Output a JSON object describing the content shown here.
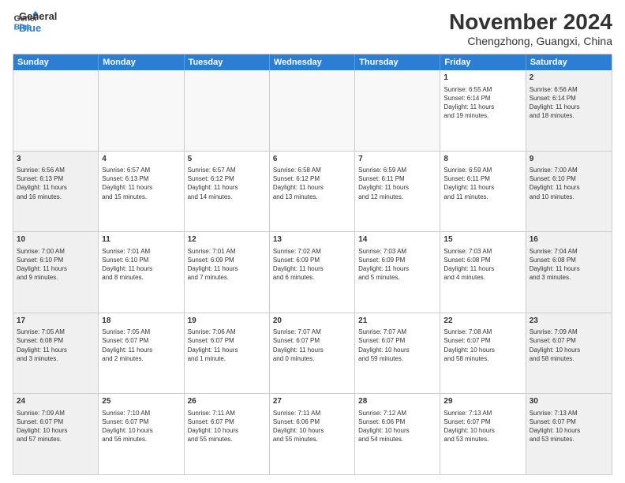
{
  "logo": {
    "line1": "General",
    "line2": "Blue"
  },
  "title": "November 2024",
  "location": "Chengzhong, Guangxi, China",
  "header_days": [
    "Sunday",
    "Monday",
    "Tuesday",
    "Wednesday",
    "Thursday",
    "Friday",
    "Saturday"
  ],
  "rows": [
    [
      {
        "day": "",
        "info": "",
        "empty": true
      },
      {
        "day": "",
        "info": "",
        "empty": true
      },
      {
        "day": "",
        "info": "",
        "empty": true
      },
      {
        "day": "",
        "info": "",
        "empty": true
      },
      {
        "day": "",
        "info": "",
        "empty": true
      },
      {
        "day": "1",
        "info": "Sunrise: 6:55 AM\nSunset: 6:14 PM\nDaylight: 11 hours\nand 19 minutes.",
        "empty": false
      },
      {
        "day": "2",
        "info": "Sunrise: 6:56 AM\nSunset: 6:14 PM\nDaylight: 11 hours\nand 18 minutes.",
        "empty": false
      }
    ],
    [
      {
        "day": "3",
        "info": "Sunrise: 6:56 AM\nSunset: 6:13 PM\nDaylight: 11 hours\nand 16 minutes.",
        "empty": false
      },
      {
        "day": "4",
        "info": "Sunrise: 6:57 AM\nSunset: 6:13 PM\nDaylight: 11 hours\nand 15 minutes.",
        "empty": false
      },
      {
        "day": "5",
        "info": "Sunrise: 6:57 AM\nSunset: 6:12 PM\nDaylight: 11 hours\nand 14 minutes.",
        "empty": false
      },
      {
        "day": "6",
        "info": "Sunrise: 6:58 AM\nSunset: 6:12 PM\nDaylight: 11 hours\nand 13 minutes.",
        "empty": false
      },
      {
        "day": "7",
        "info": "Sunrise: 6:59 AM\nSunset: 6:11 PM\nDaylight: 11 hours\nand 12 minutes.",
        "empty": false
      },
      {
        "day": "8",
        "info": "Sunrise: 6:59 AM\nSunset: 6:11 PM\nDaylight: 11 hours\nand 11 minutes.",
        "empty": false
      },
      {
        "day": "9",
        "info": "Sunrise: 7:00 AM\nSunset: 6:10 PM\nDaylight: 11 hours\nand 10 minutes.",
        "empty": false
      }
    ],
    [
      {
        "day": "10",
        "info": "Sunrise: 7:00 AM\nSunset: 6:10 PM\nDaylight: 11 hours\nand 9 minutes.",
        "empty": false
      },
      {
        "day": "11",
        "info": "Sunrise: 7:01 AM\nSunset: 6:10 PM\nDaylight: 11 hours\nand 8 minutes.",
        "empty": false
      },
      {
        "day": "12",
        "info": "Sunrise: 7:01 AM\nSunset: 6:09 PM\nDaylight: 11 hours\nand 7 minutes.",
        "empty": false
      },
      {
        "day": "13",
        "info": "Sunrise: 7:02 AM\nSunset: 6:09 PM\nDaylight: 11 hours\nand 6 minutes.",
        "empty": false
      },
      {
        "day": "14",
        "info": "Sunrise: 7:03 AM\nSunset: 6:09 PM\nDaylight: 11 hours\nand 5 minutes.",
        "empty": false
      },
      {
        "day": "15",
        "info": "Sunrise: 7:03 AM\nSunset: 6:08 PM\nDaylight: 11 hours\nand 4 minutes.",
        "empty": false
      },
      {
        "day": "16",
        "info": "Sunrise: 7:04 AM\nSunset: 6:08 PM\nDaylight: 11 hours\nand 3 minutes.",
        "empty": false
      }
    ],
    [
      {
        "day": "17",
        "info": "Sunrise: 7:05 AM\nSunset: 6:08 PM\nDaylight: 11 hours\nand 3 minutes.",
        "empty": false
      },
      {
        "day": "18",
        "info": "Sunrise: 7:05 AM\nSunset: 6:07 PM\nDaylight: 11 hours\nand 2 minutes.",
        "empty": false
      },
      {
        "day": "19",
        "info": "Sunrise: 7:06 AM\nSunset: 6:07 PM\nDaylight: 11 hours\nand 1 minute.",
        "empty": false
      },
      {
        "day": "20",
        "info": "Sunrise: 7:07 AM\nSunset: 6:07 PM\nDaylight: 11 hours\nand 0 minutes.",
        "empty": false
      },
      {
        "day": "21",
        "info": "Sunrise: 7:07 AM\nSunset: 6:07 PM\nDaylight: 10 hours\nand 59 minutes.",
        "empty": false
      },
      {
        "day": "22",
        "info": "Sunrise: 7:08 AM\nSunset: 6:07 PM\nDaylight: 10 hours\nand 58 minutes.",
        "empty": false
      },
      {
        "day": "23",
        "info": "Sunrise: 7:09 AM\nSunset: 6:07 PM\nDaylight: 10 hours\nand 58 minutes.",
        "empty": false
      }
    ],
    [
      {
        "day": "24",
        "info": "Sunrise: 7:09 AM\nSunset: 6:07 PM\nDaylight: 10 hours\nand 57 minutes.",
        "empty": false
      },
      {
        "day": "25",
        "info": "Sunrise: 7:10 AM\nSunset: 6:07 PM\nDaylight: 10 hours\nand 56 minutes.",
        "empty": false
      },
      {
        "day": "26",
        "info": "Sunrise: 7:11 AM\nSunset: 6:07 PM\nDaylight: 10 hours\nand 55 minutes.",
        "empty": false
      },
      {
        "day": "27",
        "info": "Sunrise: 7:11 AM\nSunset: 6:06 PM\nDaylight: 10 hours\nand 55 minutes.",
        "empty": false
      },
      {
        "day": "28",
        "info": "Sunrise: 7:12 AM\nSunset: 6:06 PM\nDaylight: 10 hours\nand 54 minutes.",
        "empty": false
      },
      {
        "day": "29",
        "info": "Sunrise: 7:13 AM\nSunset: 6:07 PM\nDaylight: 10 hours\nand 53 minutes.",
        "empty": false
      },
      {
        "day": "30",
        "info": "Sunrise: 7:13 AM\nSunset: 6:07 PM\nDaylight: 10 hours\nand 53 minutes.",
        "empty": false
      }
    ]
  ]
}
